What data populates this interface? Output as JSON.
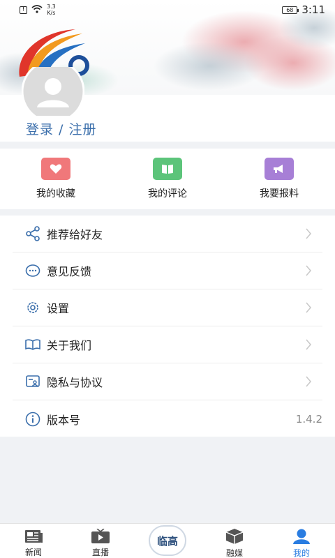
{
  "status_bar": {
    "speed_value": "3.3",
    "speed_unit": "K/s",
    "battery": "68",
    "time": "3:11"
  },
  "header": {
    "login_text": "登录 / 注册"
  },
  "quick_actions": [
    {
      "label": "我的收藏",
      "icon": "heart-icon",
      "color": "#f0787a"
    },
    {
      "label": "我的评论",
      "icon": "book-icon",
      "color": "#5cc47a"
    },
    {
      "label": "我要报料",
      "icon": "megaphone-icon",
      "color": "#a77fd6"
    }
  ],
  "menu": [
    {
      "label": "推荐给好友",
      "icon": "share-icon"
    },
    {
      "label": "意见反馈",
      "icon": "feedback-icon"
    },
    {
      "label": "设置",
      "icon": "gear-icon"
    },
    {
      "label": "关于我们",
      "icon": "open-book-icon"
    },
    {
      "label": "隐私与协议",
      "icon": "privacy-icon"
    },
    {
      "label": "版本号",
      "icon": "info-icon",
      "value": "1.4.2"
    }
  ],
  "tabbar": {
    "tabs": [
      {
        "label": "新闻",
        "icon": "news-icon"
      },
      {
        "label": "直播",
        "icon": "tv-icon"
      },
      {
        "label": "",
        "icon": "center-logo"
      },
      {
        "label": "融媒",
        "icon": "cube-icon"
      },
      {
        "label": "我的",
        "icon": "user-icon"
      }
    ],
    "center_text": "临高"
  },
  "colors": {
    "accent": "#2a7de1",
    "link": "#3a6eab"
  }
}
